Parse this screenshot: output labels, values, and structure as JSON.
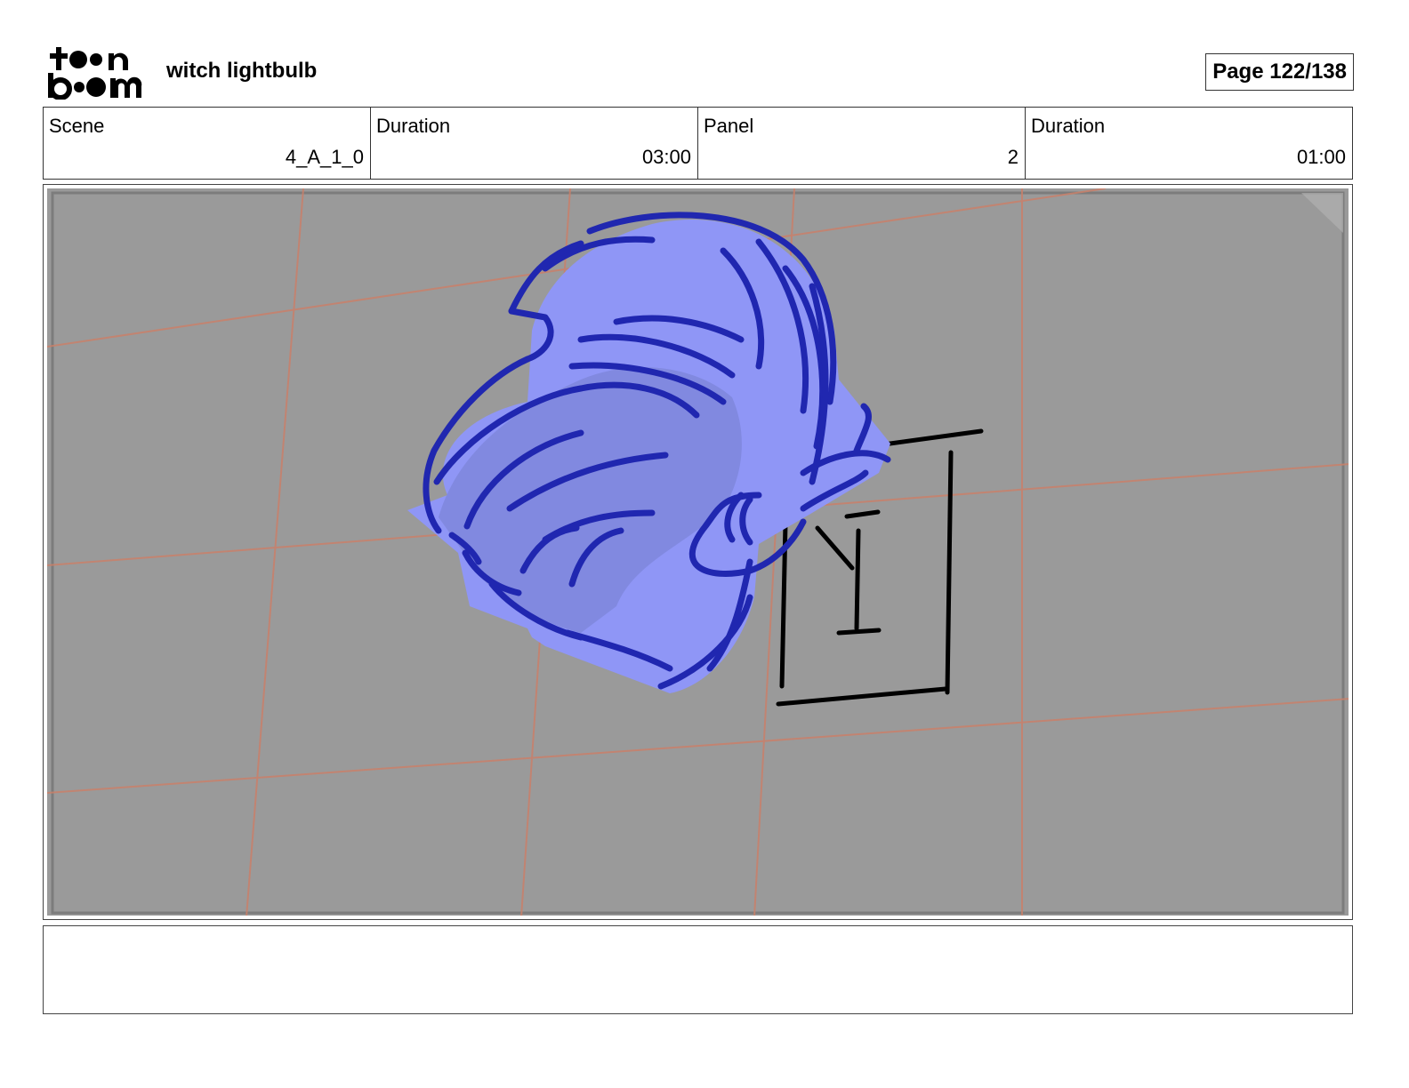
{
  "header": {
    "logo_text_top": "toon",
    "logo_text_bottom": "boom",
    "project_title": "witch lightbulb",
    "page_indicator": "Page 122/138"
  },
  "info": {
    "scene_label": "Scene",
    "scene_value": "4_A_1_0",
    "scene_duration_label": "Duration",
    "scene_duration_value": "03:00",
    "panel_label": "Panel",
    "panel_value": "2",
    "panel_duration_label": "Duration",
    "panel_duration_value": "01:00"
  },
  "panel": {
    "sign_text": "Y I",
    "colors": {
      "background": "#9a9a9a",
      "perspective_grid": "#c9806a",
      "fill_light": "#8f96f6",
      "fill_shadow": "#7f87dc",
      "outline": "#2027b0",
      "sign_lines": "#000000"
    }
  },
  "notes": {
    "text": ""
  }
}
